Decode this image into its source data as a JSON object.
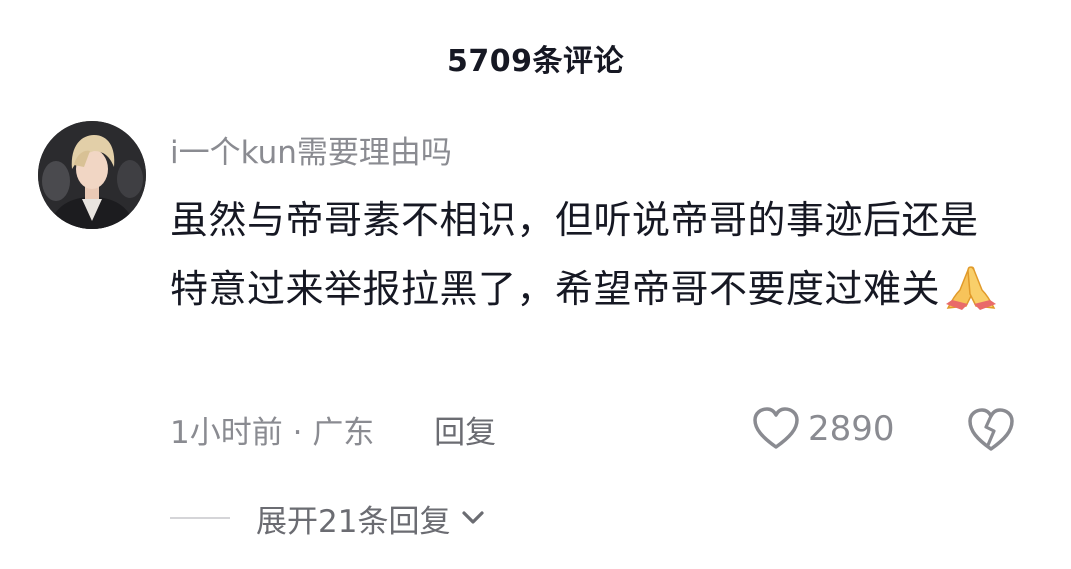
{
  "header": {
    "title": "5709条评论"
  },
  "comment": {
    "username": "i一个kun需要理由吗",
    "text": "虽然与帝哥素不相识，但听说帝哥的事迹后还是特意过来举报拉黑了，希望帝哥不要度过难关",
    "emoji": "folded-hands-emoji",
    "time": "1小时前",
    "separator": "·",
    "location": "广东",
    "reply_label": "回复",
    "like_count": "2890",
    "expand_label": "展开21条回复"
  },
  "icons": {
    "like": "heart-outline-icon",
    "dislike": "broken-heart-icon",
    "expand": "chevron-down-icon"
  },
  "colors": {
    "primary_text": "#161823",
    "secondary_text": "#8a8b91",
    "background": "#ffffff"
  }
}
